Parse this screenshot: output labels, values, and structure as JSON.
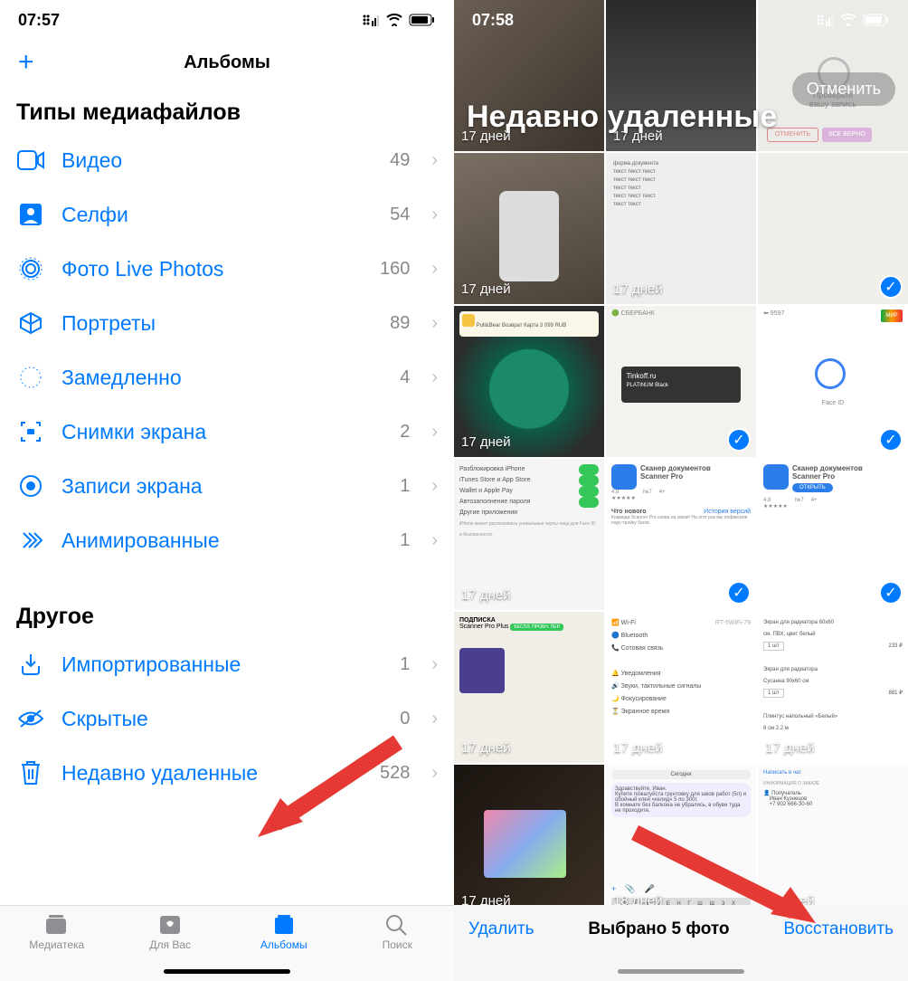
{
  "left": {
    "status_time": "07:57",
    "nav_title": "Альбомы",
    "section1": "Типы медиафайлов",
    "section2": "Другое",
    "rows1": [
      {
        "label": "Видео",
        "count": "49",
        "icon": "video-icon"
      },
      {
        "label": "Селфи",
        "count": "54",
        "icon": "selfie-icon"
      },
      {
        "label": "Фото Live Photos",
        "count": "160",
        "icon": "livephoto-icon"
      },
      {
        "label": "Портреты",
        "count": "89",
        "icon": "cube-icon"
      },
      {
        "label": "Замедленно",
        "count": "4",
        "icon": "slowmo-icon"
      },
      {
        "label": "Снимки экрана",
        "count": "2",
        "icon": "screenshot-icon"
      },
      {
        "label": "Записи экрана",
        "count": "1",
        "icon": "record-icon"
      },
      {
        "label": "Анимированные",
        "count": "1",
        "icon": "animated-icon"
      }
    ],
    "rows2": [
      {
        "label": "Импортированные",
        "count": "1",
        "icon": "import-icon"
      },
      {
        "label": "Скрытые",
        "count": "0",
        "icon": "hidden-icon"
      },
      {
        "label": "Недавно удаленные",
        "count": "528",
        "icon": "trash-icon"
      }
    ],
    "tabs": [
      {
        "label": "Медиатека"
      },
      {
        "label": "Для Вас"
      },
      {
        "label": "Альбомы"
      },
      {
        "label": "Поиск"
      }
    ]
  },
  "right": {
    "status_time": "07:58",
    "title": "Недавно удаленные",
    "cancel": "Отменить",
    "delete": "Удалить",
    "selected": "Выбрано 5 фото",
    "recover": "Восстановить",
    "thumbs": [
      {
        "days": "17 дней",
        "checked": false,
        "bg": "#5a5550"
      },
      {
        "days": "17 дней",
        "checked": false,
        "bg": "#3a3a3a"
      },
      {
        "days": "",
        "checked": false,
        "bg": "#ecebe8"
      },
      {
        "days": "17 дней",
        "checked": false,
        "bg": "#6b6560"
      },
      {
        "days": "17 дней",
        "checked": false,
        "bg": "#e8e8e8"
      },
      {
        "days": "",
        "checked": true,
        "bg": "#f0efe9"
      },
      {
        "days": "17 дней",
        "checked": false,
        "bg": "#3fa183"
      },
      {
        "days": "",
        "checked": true,
        "bg": "#f3f2ee"
      },
      {
        "days": "",
        "checked": true,
        "bg": "#f5f5f5"
      },
      {
        "days": "17 дней",
        "checked": false,
        "bg": "#f2f2ef"
      },
      {
        "days": "",
        "checked": true,
        "bg": "#ffffff"
      },
      {
        "days": "",
        "checked": true,
        "bg": "#ffffff"
      },
      {
        "days": "17 дней",
        "checked": false,
        "bg": "#eceae4"
      },
      {
        "days": "17 дней",
        "checked": false,
        "bg": "#ffffff"
      },
      {
        "days": "17 дней",
        "checked": false,
        "bg": "#ffffff"
      },
      {
        "days": "17 дней",
        "checked": false,
        "bg": "#302a24"
      },
      {
        "days": "18 дней",
        "checked": false,
        "bg": "#f6f6f6"
      },
      {
        "days": "18 дней",
        "checked": false,
        "bg": "#f6f6f6"
      }
    ]
  }
}
